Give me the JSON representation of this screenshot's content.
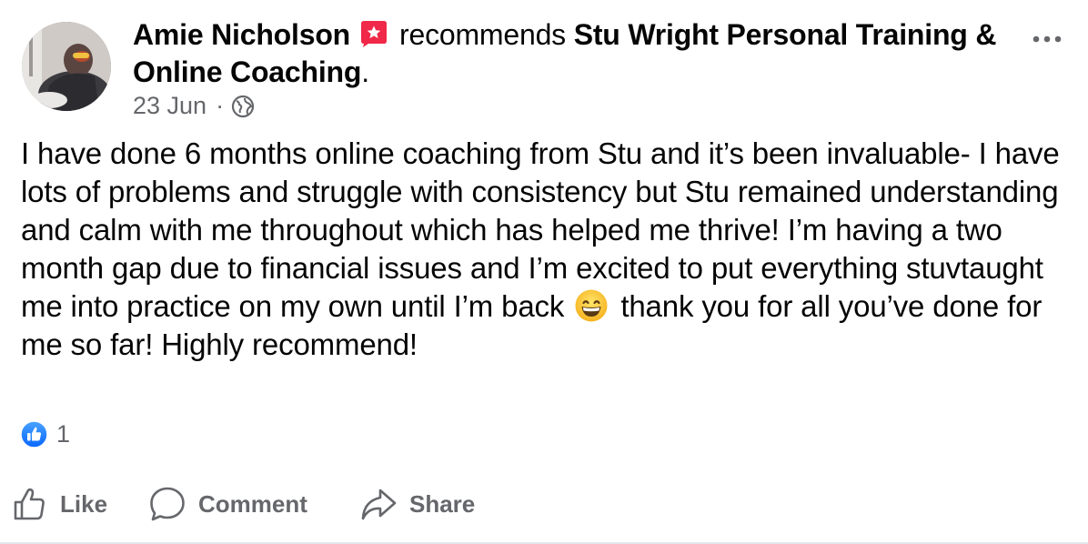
{
  "post": {
    "author": "Amie Nicholson",
    "verb": "recommends",
    "page_name": "Stu Wright Personal Training & Online Coaching",
    "page_suffix": ".",
    "date": "23 Jun",
    "separator": "·",
    "audience_icon": "globe-icon",
    "more_icon": "more-options-icon",
    "body_before_emoji": "I have done 6 months online coaching from Stu and it’s been invaluable- I have lots of problems and struggle with consistency but Stu remained understanding and calm with me throughout which has helped me thrive! I’m having a two month gap due to financial issues and I’m excited to put everything stuvtaught me into practice on my own until I’m back",
    "emoji": "grinning-face-emoji",
    "body_after_emoji": "thank you for all you’ve done for me so far! Highly recommend!"
  },
  "reactions": {
    "icon": "like-reaction-icon",
    "count": "1"
  },
  "actions": {
    "like_label": "Like",
    "comment_label": "Comment",
    "share_label": "Share"
  },
  "colors": {
    "text": "#050505",
    "secondary": "#65676b",
    "like_blue": "#1877f2",
    "recommend_red": "#f02849"
  }
}
